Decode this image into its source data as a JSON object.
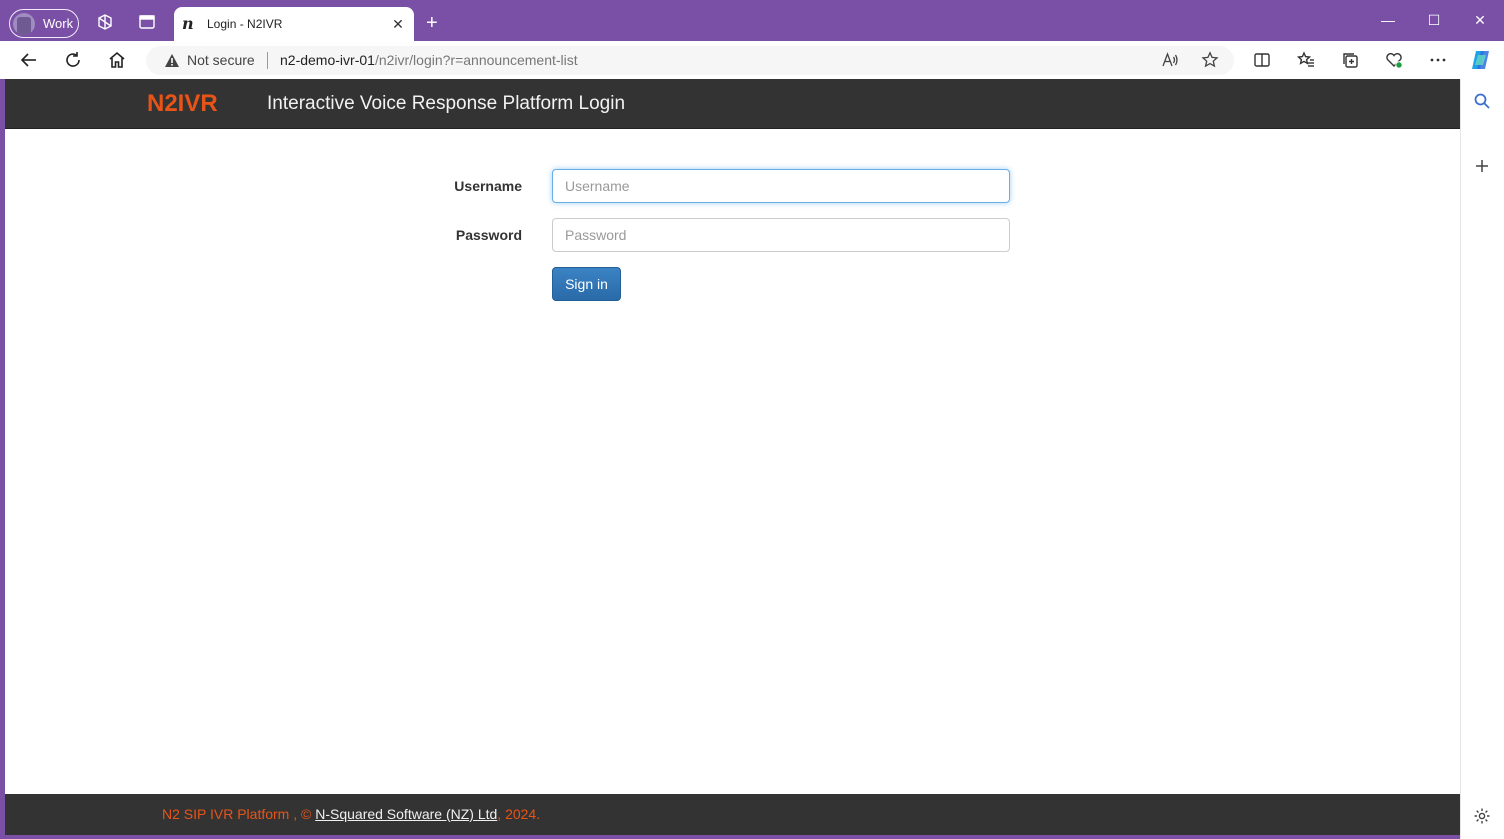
{
  "browser": {
    "profile_label": "Work",
    "tab": {
      "favicon": "n",
      "title": "Login - N2IVR",
      "close_glyph": "✕"
    },
    "new_tab_glyph": "+",
    "address": {
      "security_label": "Not secure",
      "url_host": "n2-demo-ivr-01",
      "url_path": "/n2ivr/login?r=announcement-list"
    },
    "window_controls": {
      "minimize": "—",
      "maximize": "☐",
      "close": "✕"
    }
  },
  "header": {
    "brand": "N2IVR",
    "title": "Interactive Voice Response Platform Login"
  },
  "form": {
    "username_label": "Username",
    "username_placeholder": "Username",
    "username_value": "",
    "password_label": "Password",
    "password_placeholder": "Password",
    "password_value": "",
    "submit_label": "Sign in"
  },
  "footer": {
    "prefix": "N2 SIP IVR Platform , © ",
    "company_link": "N-Squared Software (NZ) Ltd",
    "suffix": ", 2024."
  },
  "colors": {
    "browser_frame": "#7a4fa6",
    "header_bg": "#333333",
    "brand_accent": "#e85417",
    "button_primary": "#337ab7"
  }
}
